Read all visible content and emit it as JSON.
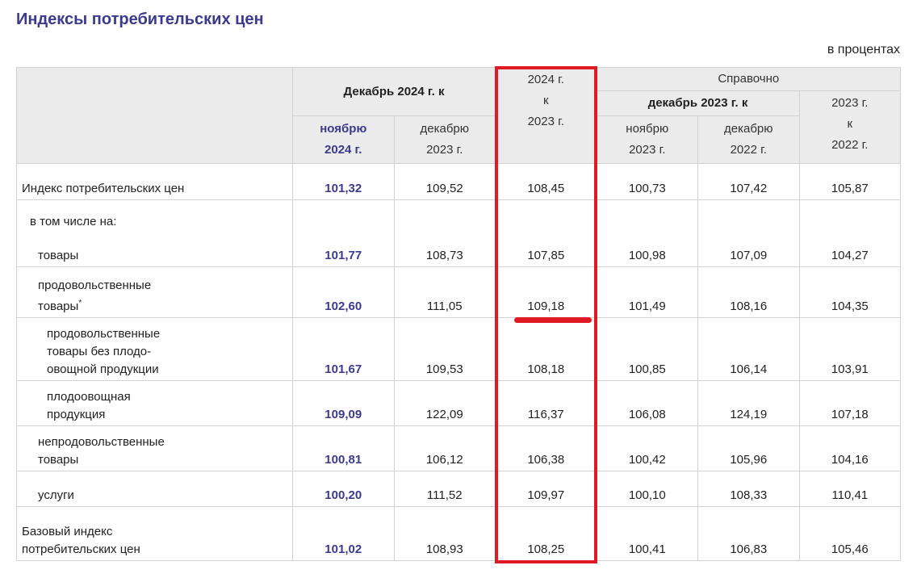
{
  "page": {
    "title": "Индексы потребительских цен",
    "unit": "в процентах"
  },
  "headers": {
    "group_dec2024": "Декабрь 2024 г. к",
    "col_nov2024_line1": "ноябрю",
    "col_nov2024_line2": "2024 г.",
    "col_dec2023_line1": "декабрю",
    "col_dec2023_line2": "2023 г.",
    "col_2024_line1": "2024 г.",
    "col_2024_line2": "к",
    "col_2024_line3": "2023 г.",
    "ref_group": "Справочно",
    "ref_dec2023": "декабрь 2023 г. к",
    "ref_nov2023_line1": "ноябрю",
    "ref_nov2023_line2": "2023 г.",
    "ref_dec2022_line1": "декабрю",
    "ref_dec2022_line2": "2022 г.",
    "ref_2023_line1": "2023 г.",
    "ref_2023_line2": "к",
    "ref_2023_line3": "2022 г."
  },
  "rows": [
    {
      "label_lines": [
        "Индекс потребительских цен"
      ],
      "values": [
        "101,32",
        "109,52",
        "108,45",
        "100,73",
        "107,42",
        "105,87"
      ]
    },
    {
      "section": "в том числе на:"
    },
    {
      "label_lines": [
        "товары"
      ],
      "values": [
        "101,77",
        "108,73",
        "107,85",
        "100,98",
        "107,09",
        "104,27"
      ]
    },
    {
      "label_lines": [
        "продовольственные",
        "товары"
      ],
      "footnote": "*",
      "values": [
        "102,60",
        "111,05",
        "109,18",
        "101,49",
        "108,16",
        "104,35"
      ]
    },
    {
      "label_lines": [
        "продовольственные",
        "товары без плодо-",
        "овощной продукции"
      ],
      "values": [
        "101,67",
        "109,53",
        "108,18",
        "100,85",
        "106,14",
        "103,91"
      ]
    },
    {
      "label_lines": [
        "плодоовощная",
        "продукция"
      ],
      "values": [
        "109,09",
        "122,09",
        "116,37",
        "106,08",
        "124,19",
        "107,18"
      ]
    },
    {
      "label_lines": [
        "непродовольственные",
        "товары"
      ],
      "values": [
        "100,81",
        "106,12",
        "106,38",
        "100,42",
        "105,96",
        "104,16"
      ]
    },
    {
      "label_lines": [
        "услуги"
      ],
      "values": [
        "100,20",
        "111,52",
        "109,97",
        "100,10",
        "108,33",
        "110,41"
      ]
    },
    {
      "label_lines": [
        "Базовый индекс",
        "потребительских цен"
      ],
      "values": [
        "101,02",
        "108,93",
        "108,25",
        "100,41",
        "106,83",
        "105,46"
      ]
    }
  ]
}
